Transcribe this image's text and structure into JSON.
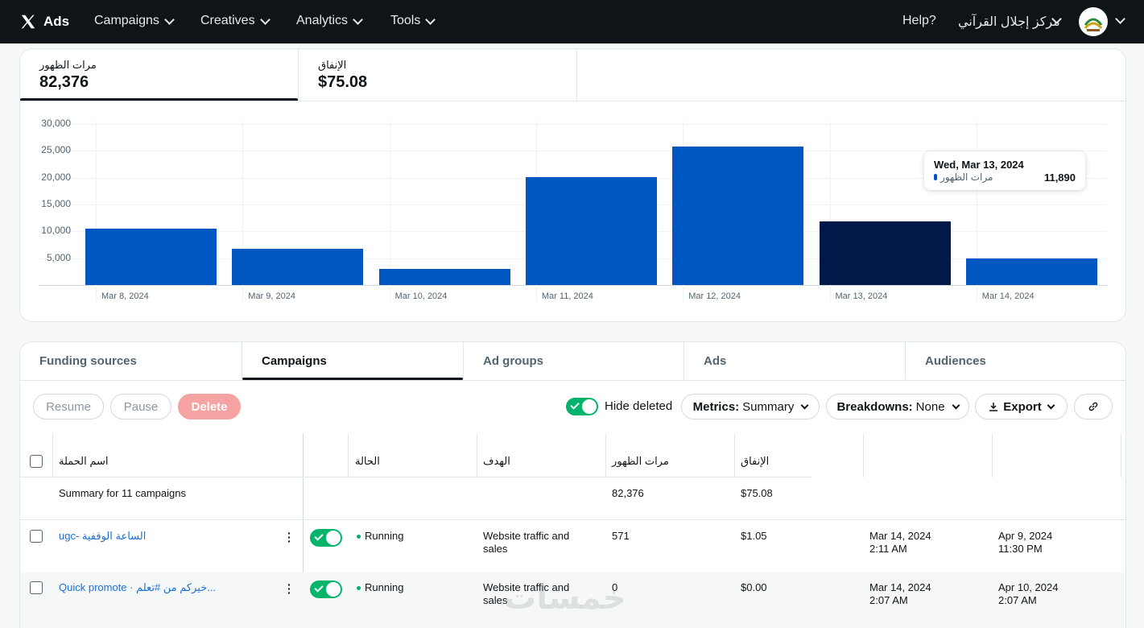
{
  "nav": {
    "brand": "Ads",
    "items": [
      "Campaigns",
      "Creatives",
      "Analytics",
      "Tools"
    ],
    "help": "Help?",
    "account": "مركز إجلال القرآني"
  },
  "metrics": {
    "impressions": {
      "label": "مرات الظهور",
      "value": "82,376"
    },
    "spend": {
      "label": "الإنفاق",
      "value": "$75.08"
    }
  },
  "chart_data": {
    "type": "bar",
    "categories": [
      "Mar 8, 2024",
      "Mar 9, 2024",
      "Mar 10, 2024",
      "Mar 11, 2024",
      "Mar 12, 2024",
      "Mar 13, 2024",
      "Mar 14, 2024"
    ],
    "values": [
      10500,
      6800,
      3000,
      20100,
      25800,
      11890,
      4900
    ],
    "ylim": [
      0,
      30000
    ],
    "yticks": [
      "30,000",
      "25,000",
      "20,000",
      "15,000",
      "10,000",
      "5,000"
    ],
    "selected_index": 5,
    "colors": {
      "bar": "#0057c2",
      "selected": "#011848"
    },
    "tooltip": {
      "date": "Wed, Mar 13, 2024",
      "series": "مرات الظهور",
      "value": "11,890"
    }
  },
  "tabs": [
    "Funding sources",
    "Campaigns",
    "Ad groups",
    "Ads",
    "Audiences"
  ],
  "toolbar": {
    "resume": "Resume",
    "pause": "Pause",
    "delete": "Delete",
    "hide_deleted": "Hide deleted",
    "metrics_key": "Metrics:",
    "metrics_val": "Summary",
    "breakdowns_key": "Breakdowns:",
    "breakdowns_val": "None",
    "export": "Export"
  },
  "table": {
    "headers": {
      "name": "اسم الحملة",
      "status": "الحالة",
      "objective": "الهدف",
      "impressions": "مرات الظهور",
      "spend": "الإنفاق"
    },
    "summary": {
      "label": "Summary for 11 campaigns",
      "impressions": "82,376",
      "spend": "$75.08"
    },
    "rows": [
      {
        "name": "الساعة الوقفية -ugc",
        "status": "Running",
        "objective_1": "Website traffic and",
        "objective_2": "sales",
        "impressions": "571",
        "spend": "$1.05",
        "start_date": "Mar 14, 2024",
        "start_time": "2:11 AM",
        "end_date": "Apr 9, 2024",
        "end_time": "11:30 PM"
      },
      {
        "name": "Quick promote · خيركم من #تعلم...",
        "status": "Running",
        "objective_1": "Website traffic and",
        "objective_2": "sales",
        "impressions": "0",
        "spend": "$0.00",
        "start_date": "Mar 14, 2024",
        "start_time": "2:07 AM",
        "end_date": "Apr 10, 2024",
        "end_time": "2:07 AM"
      }
    ]
  },
  "watermark": "خمسات"
}
